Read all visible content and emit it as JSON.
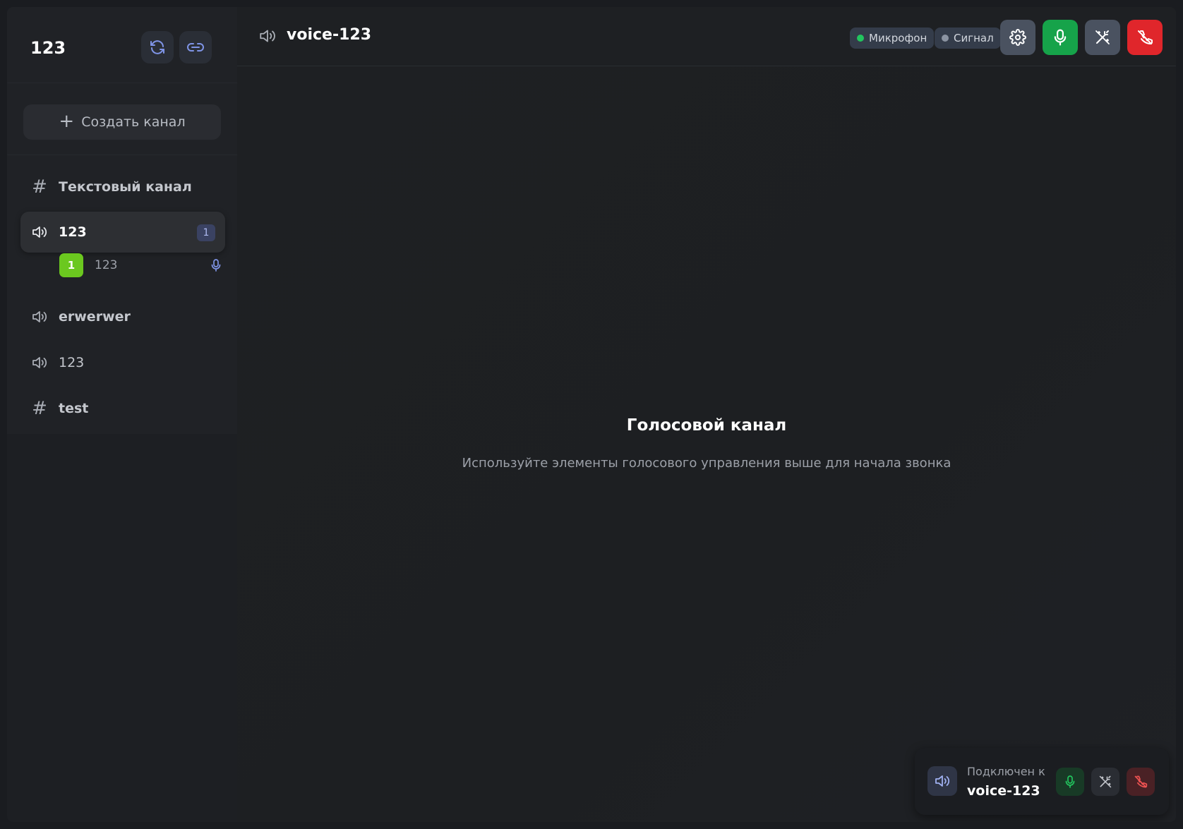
{
  "server": {
    "name": "123",
    "refresh_icon": "refresh-icon",
    "invite_icon": "link-icon"
  },
  "sidebar": {
    "create_channel_label": "Создать канал",
    "channels": [
      {
        "type": "text",
        "icon": "hash-icon",
        "label": "Текстовый канал",
        "active": false
      },
      {
        "type": "voice",
        "icon": "speaker-icon",
        "label": "123",
        "active": true,
        "count": "1"
      },
      {
        "type": "voice",
        "icon": "speaker-icon",
        "label": "erwerwer",
        "active": false
      },
      {
        "type": "voice",
        "icon": "speaker-icon",
        "label": "123",
        "active": false
      },
      {
        "type": "text",
        "icon": "hash-icon",
        "label": "test",
        "active": false
      }
    ],
    "members": [
      {
        "avatar": "1",
        "name": "123",
        "status_icon": "mic-icon"
      }
    ]
  },
  "topbar": {
    "channel_title": "voice-123",
    "status_mic": "Микрофон",
    "status_signal": "Сигнал",
    "buttons": [
      "settings-icon",
      "mic-icon",
      "wand-icon",
      "hangup-icon"
    ]
  },
  "main": {
    "title": "Голосовой канал",
    "subtitle": "Используйте элементы голосового управления выше для начала звонка"
  },
  "connection": {
    "label": "Подключен к",
    "channel": "voice-123"
  },
  "colors": {
    "accent_green": "#16a34a",
    "danger_red": "#e0262b",
    "status_green": "#22c55e",
    "status_gray": "#8b93a1",
    "avatar_green": "#6bc81f"
  }
}
